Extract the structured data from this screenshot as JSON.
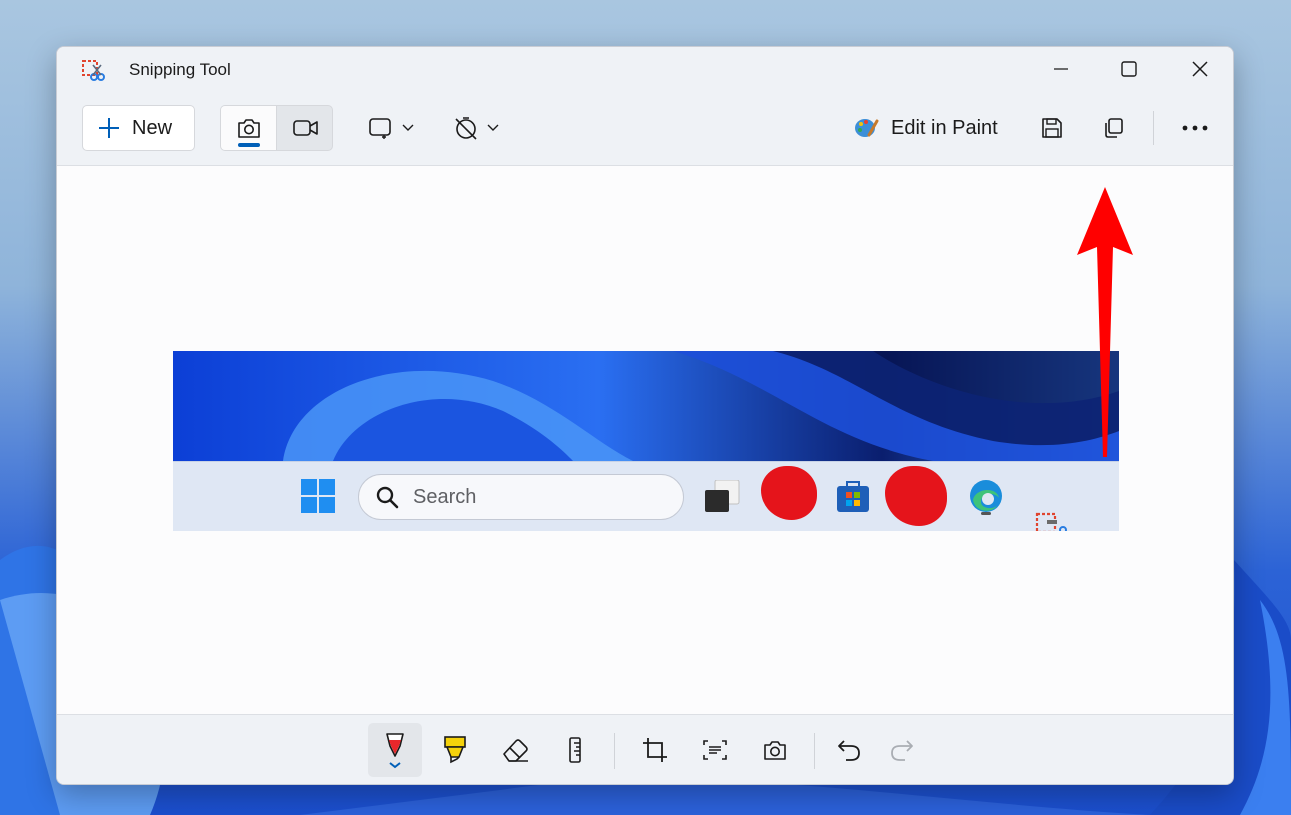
{
  "window": {
    "title": "Snipping Tool",
    "controls": [
      "minimize",
      "maximize",
      "close"
    ]
  },
  "toolbar": {
    "new_label": "New",
    "modes": [
      {
        "name": "snip",
        "icon": "camera-icon",
        "selected": true
      },
      {
        "name": "record",
        "icon": "video-icon",
        "selected": false
      }
    ],
    "snip_shape_icon": "rectangle-snip-icon",
    "timer_icon": "no-delay-timer-icon",
    "edit_in_paint_label": "Edit in Paint",
    "actions": [
      "save-icon",
      "copy-icon",
      "more-icon"
    ]
  },
  "snip_preview": {
    "search_placeholder": "Search"
  },
  "bottom_tools": [
    "ballpoint-pen-icon",
    "highlighter-icon",
    "eraser-icon",
    "ruler-icon",
    "crop-icon",
    "text-actions-icon",
    "screenshot-icon",
    "undo-icon",
    "redo-icon"
  ],
  "colors": {
    "accent": "#005fb8",
    "annotation_arrow": "#ff0000",
    "redaction": "#e5141b",
    "pen_red": "#e8272b",
    "highlighter_yellow": "#f5d20b"
  }
}
